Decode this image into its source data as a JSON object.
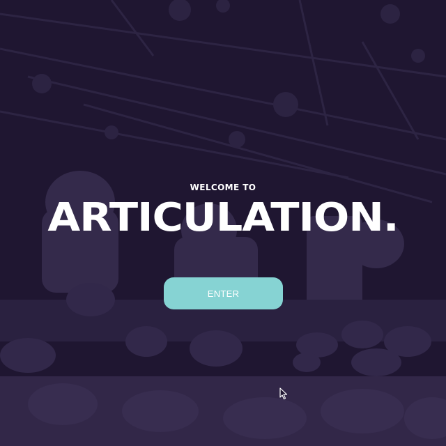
{
  "hero": {
    "welcome_text": "WELCOME TO",
    "title": "ARTICULATION.",
    "enter_label": "ENTER"
  },
  "background": {
    "description_icon": "concert-crowd-background",
    "base_color": "#1f1631",
    "texture_color": "#2e2445"
  },
  "colors": {
    "accent": "#86d3d3",
    "text": "#ffffff"
  },
  "pointer": {
    "icon": "mouse-pointer-icon"
  }
}
